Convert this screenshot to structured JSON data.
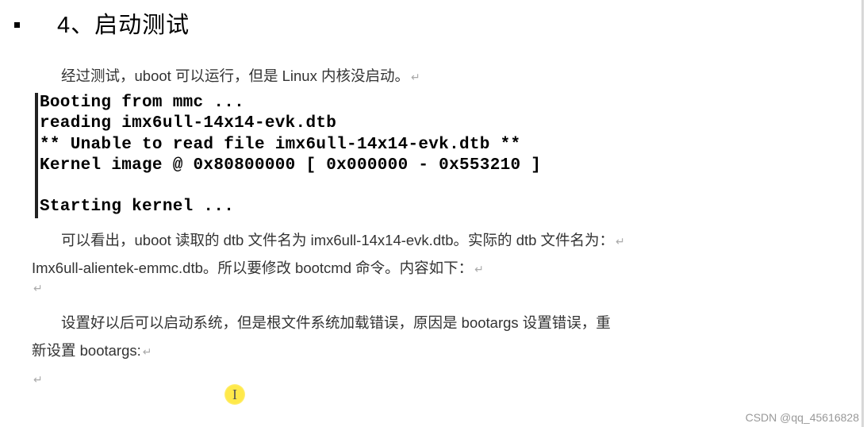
{
  "heading": "4、启动测试",
  "paragraphs": {
    "p1_prefix": "经过测试，",
    "p1_uboot": "uboot",
    "p1_mid": " 可以运行，但是 Linux ",
    "p1_kernel": "内核没",
    "p1_suffix": "启动。",
    "p2_prefix": "可以看出，",
    "p2_uboot": "uboot",
    "p2_mid1": " 读取的 ",
    "p2_dtb1": "dtb",
    "p2_mid2": " 文件名为 imx6ull-14x14-evk.dtb。实际的 ",
    "p2_dtb2": "dtb",
    "p2_suffix": " 文件名为：",
    "p3_prefix": "Imx6ull-alientek-emmc.dtb。所以要修改 ",
    "p3_bootcmd": "bootcmd",
    "p3_suffix": " 命令。内容如下：",
    "p4_prefix": "设置好以后可以启动系统，但是根文件系统加载错误，原因是 ",
    "p4_bootargs": "bootargs",
    "p4_mid": " 设置错误，重",
    "p5_prefix": "新设置 ",
    "p5_bootargs": "bootargs:"
  },
  "code": {
    "line1": "Booting from mmc ...",
    "line2": "reading imx6ull-14x14-evk.dtb",
    "line3": "** Unable to read file imx6ull-14x14-evk.dtb **",
    "line4": "Kernel image @ 0x80800000 [ 0x000000 - 0x553210 ]",
    "line5": "",
    "line6": "Starting kernel ..."
  },
  "cursor_glyph": "I",
  "watermark": "CSDN @qq_45616828",
  "para_mark": "↵"
}
